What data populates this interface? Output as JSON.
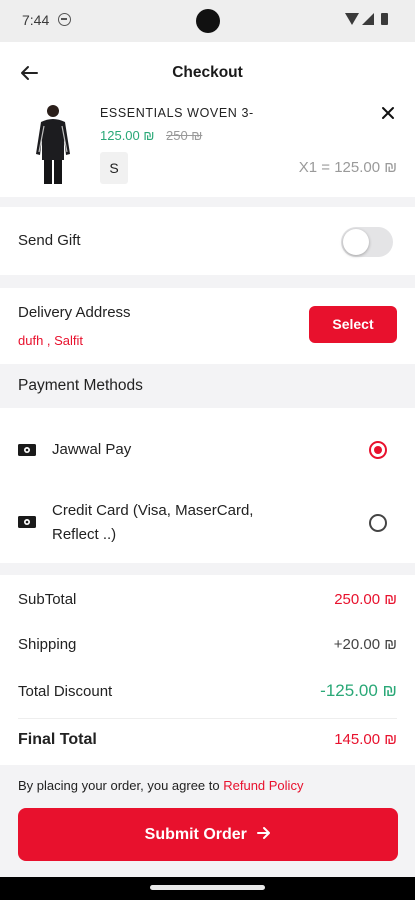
{
  "status_bar": {
    "time": "7:44"
  },
  "header": {
    "title": "Checkout"
  },
  "product": {
    "name": "ESSENTIALS WOVEN 3-",
    "price": "125.00 ₪",
    "old_price": "250 ₪",
    "size": "S",
    "qty_total": "X1 = 125.00 ₪"
  },
  "gift": {
    "label": "Send Gift",
    "enabled": false
  },
  "delivery": {
    "label": "Delivery Address",
    "address": "dufh , Salfit",
    "select_label": "Select"
  },
  "payment": {
    "title": "Payment Methods",
    "methods": [
      {
        "label": "Jawwal Pay",
        "selected": true,
        "icon": "cash-icon"
      },
      {
        "label_line1": "Credit Card (Visa, MaserCard,",
        "label_line2": "Reflect ..)",
        "selected": false,
        "icon": "cash-icon"
      }
    ]
  },
  "summary": {
    "subtotal_label": "SubTotal",
    "subtotal_value": "250.00 ₪",
    "shipping_label": "Shipping",
    "shipping_value": "+20.00 ₪",
    "discount_label": "Total Discount",
    "discount_value": "-125.00 ₪",
    "final_label": "Final Total",
    "final_value": "145.00 ₪"
  },
  "policy": {
    "text": "By placing your order, you agree to ",
    "link": "Refund Policy"
  },
  "submit": {
    "label": "Submit Order"
  },
  "colors": {
    "accent": "#e8112d",
    "green": "#2aa877",
    "muted": "#9a9a9a"
  }
}
